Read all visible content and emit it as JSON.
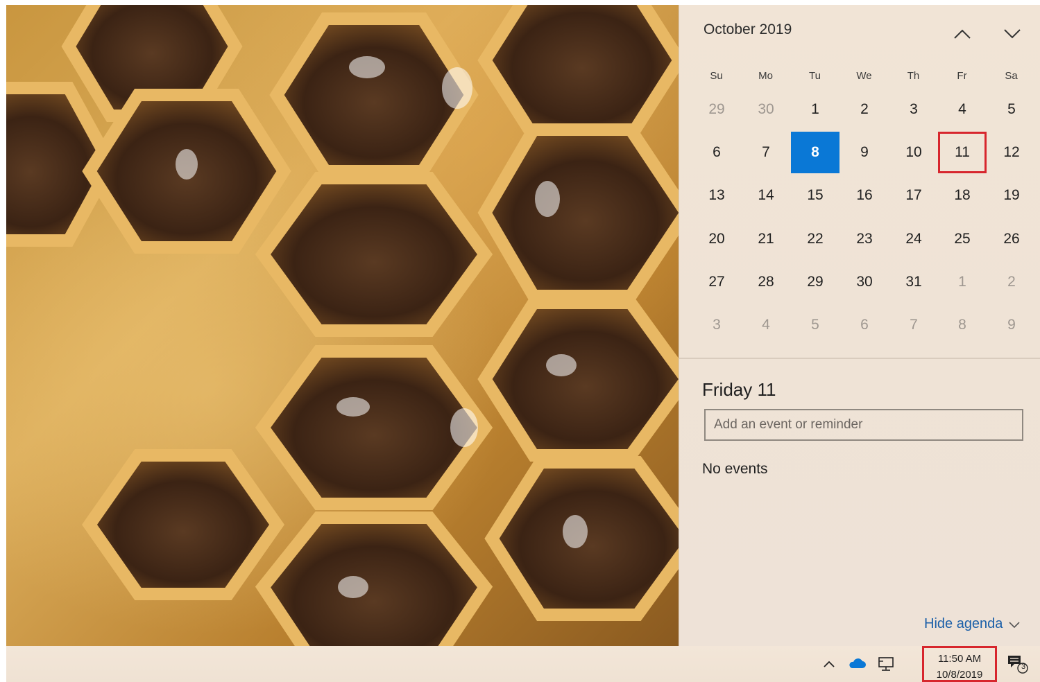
{
  "calendar": {
    "month_label": "October 2019",
    "weekdays": [
      "Su",
      "Mo",
      "Tu",
      "We",
      "Th",
      "Fr",
      "Sa"
    ],
    "weeks": [
      [
        {
          "d": "29",
          "cur": false
        },
        {
          "d": "30",
          "cur": false
        },
        {
          "d": "1",
          "cur": true
        },
        {
          "d": "2",
          "cur": true
        },
        {
          "d": "3",
          "cur": true
        },
        {
          "d": "4",
          "cur": true
        },
        {
          "d": "5",
          "cur": true
        }
      ],
      [
        {
          "d": "6",
          "cur": true
        },
        {
          "d": "7",
          "cur": true
        },
        {
          "d": "8",
          "cur": true,
          "today": true
        },
        {
          "d": "9",
          "cur": true
        },
        {
          "d": "10",
          "cur": true
        },
        {
          "d": "11",
          "cur": true,
          "selected": true
        },
        {
          "d": "12",
          "cur": true
        }
      ],
      [
        {
          "d": "13",
          "cur": true
        },
        {
          "d": "14",
          "cur": true
        },
        {
          "d": "15",
          "cur": true
        },
        {
          "d": "16",
          "cur": true
        },
        {
          "d": "17",
          "cur": true
        },
        {
          "d": "18",
          "cur": true
        },
        {
          "d": "19",
          "cur": true
        }
      ],
      [
        {
          "d": "20",
          "cur": true
        },
        {
          "d": "21",
          "cur": true
        },
        {
          "d": "22",
          "cur": true
        },
        {
          "d": "23",
          "cur": true
        },
        {
          "d": "24",
          "cur": true
        },
        {
          "d": "25",
          "cur": true
        },
        {
          "d": "26",
          "cur": true
        }
      ],
      [
        {
          "d": "27",
          "cur": true
        },
        {
          "d": "28",
          "cur": true
        },
        {
          "d": "29",
          "cur": true
        },
        {
          "d": "30",
          "cur": true
        },
        {
          "d": "31",
          "cur": true
        },
        {
          "d": "1",
          "cur": false
        },
        {
          "d": "2",
          "cur": false
        }
      ],
      [
        {
          "d": "3",
          "cur": false
        },
        {
          "d": "4",
          "cur": false
        },
        {
          "d": "5",
          "cur": false
        },
        {
          "d": "6",
          "cur": false
        },
        {
          "d": "7",
          "cur": false
        },
        {
          "d": "8",
          "cur": false
        },
        {
          "d": "9",
          "cur": false
        }
      ]
    ],
    "prev_icon": "chevron-up-icon",
    "next_icon": "chevron-down-icon"
  },
  "agenda": {
    "date_label": "Friday 11",
    "input_placeholder": "Add an event or reminder",
    "empty_text": "No events",
    "hide_label": "Hide agenda"
  },
  "taskbar": {
    "clock_time": "11:50 AM",
    "clock_date": "10/8/2019",
    "notification_count": "3",
    "tray_icons": [
      "chevron-up-icon",
      "onedrive-cloud-icon",
      "network-icon",
      "action-center-icon"
    ]
  },
  "colors": {
    "today_highlight": "#0a78d6",
    "selection_outline": "#d7262d",
    "link": "#1a5fa8",
    "onedrive": "#0a78d6"
  }
}
